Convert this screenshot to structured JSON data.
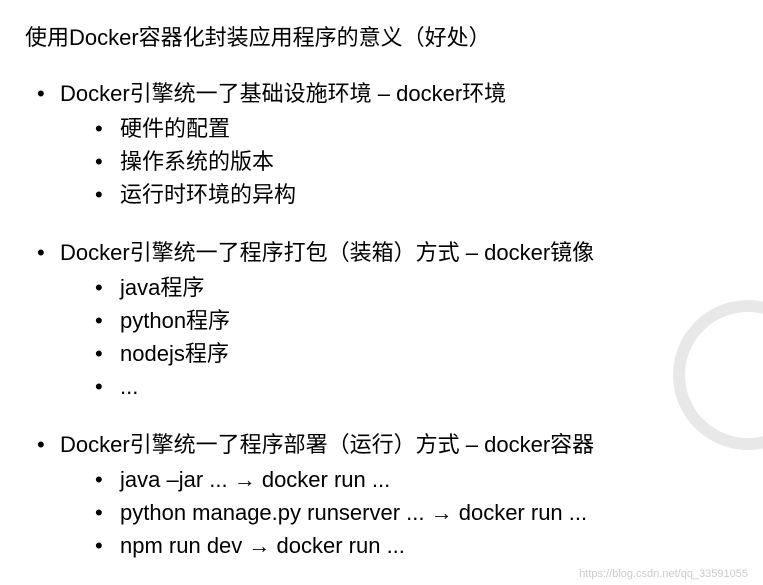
{
  "title": "使用Docker容器化封装应用程序的意义（好处）",
  "sections": [
    {
      "main": "Docker引擎统一了基础设施环境 – docker环境",
      "subs": [
        "硬件的配置",
        "操作系统的版本",
        "运行时环境的异构"
      ]
    },
    {
      "main": "Docker引擎统一了程序打包（装箱）方式 – docker镜像",
      "subs": [
        "java程序",
        "python程序",
        "nodejs程序",
        "..."
      ]
    },
    {
      "main": "Docker引擎统一了程序部署（运行）方式 – docker容器",
      "subs": [
        "java –jar ... → docker run ...",
        "python manage.py runserver ... →  docker run ...",
        "npm run dev → docker run ..."
      ]
    }
  ],
  "watermark": "https://blog.csdn.net/qq_33591055"
}
